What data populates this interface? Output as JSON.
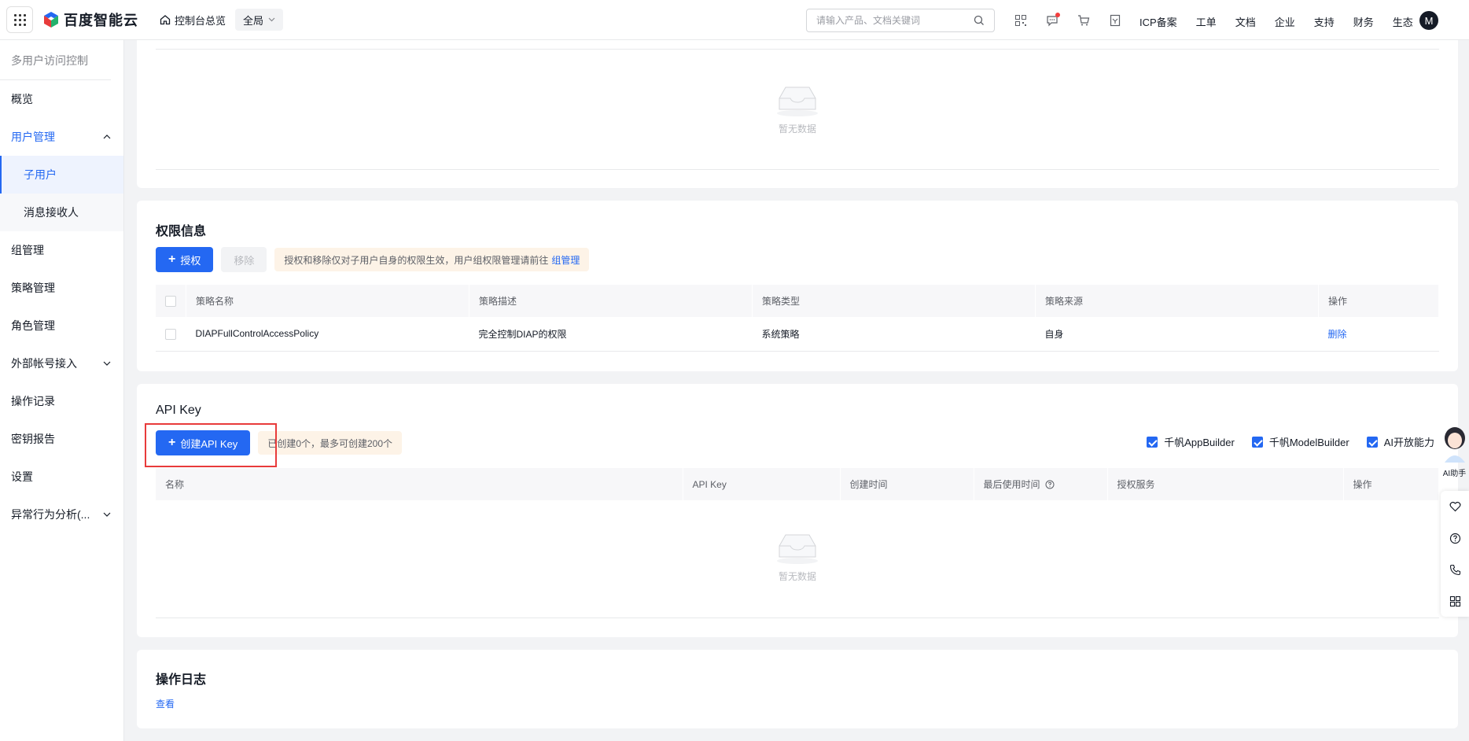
{
  "topbar": {
    "logo_text": "百度智能云",
    "console_label": "控制台总览",
    "region": "全局",
    "search_placeholder": "请输入产品、文档关键词",
    "links": [
      "ICP备案",
      "工单",
      "文档",
      "企业",
      "支持",
      "财务",
      "生态"
    ],
    "avatar_letter": "M"
  },
  "sidebar": {
    "title": "多用户访问控制",
    "items": {
      "overview": "概览",
      "user_mgmt": "用户管理",
      "sub_user": "子用户",
      "msg_receiver": "消息接收人",
      "group_mgmt": "组管理",
      "policy_mgmt": "策略管理",
      "role_mgmt": "角色管理",
      "external_account": "外部帐号接入",
      "operation_log": "操作记录",
      "key_report": "密钥报告",
      "settings": "设置",
      "anomaly": "异常行为分析(..."
    }
  },
  "top_card": {
    "empty_text": "暂无数据"
  },
  "permissions": {
    "title": "权限信息",
    "grant_label": "授权",
    "remove_label": "移除",
    "tip_text": "授权和移除仅对子用户自身的权限生效，用户组权限管理请前往",
    "tip_link": "组管理",
    "columns": [
      "策略名称",
      "策略描述",
      "策略类型",
      "策略来源",
      "操作"
    ],
    "rows": [
      {
        "name": "DIAPFullControlAccessPolicy",
        "desc": "完全控制DIAP的权限",
        "type": "系统策略",
        "source": "自身",
        "action": "删除"
      }
    ]
  },
  "api_key": {
    "title": "API Key",
    "create_label": "创建API Key",
    "tip_text": "已创建0个，最多可创建200个",
    "filters": [
      "千帆AppBuilder",
      "千帆ModelBuilder",
      "AI开放能力"
    ],
    "columns": [
      "名称",
      "API Key",
      "创建时间",
      "最后使用时间",
      "授权服务",
      "操作"
    ],
    "empty_text": "暂无数据"
  },
  "op_log": {
    "title": "操作日志",
    "view_label": "查看"
  },
  "float": {
    "ai_label": "AI助手"
  }
}
